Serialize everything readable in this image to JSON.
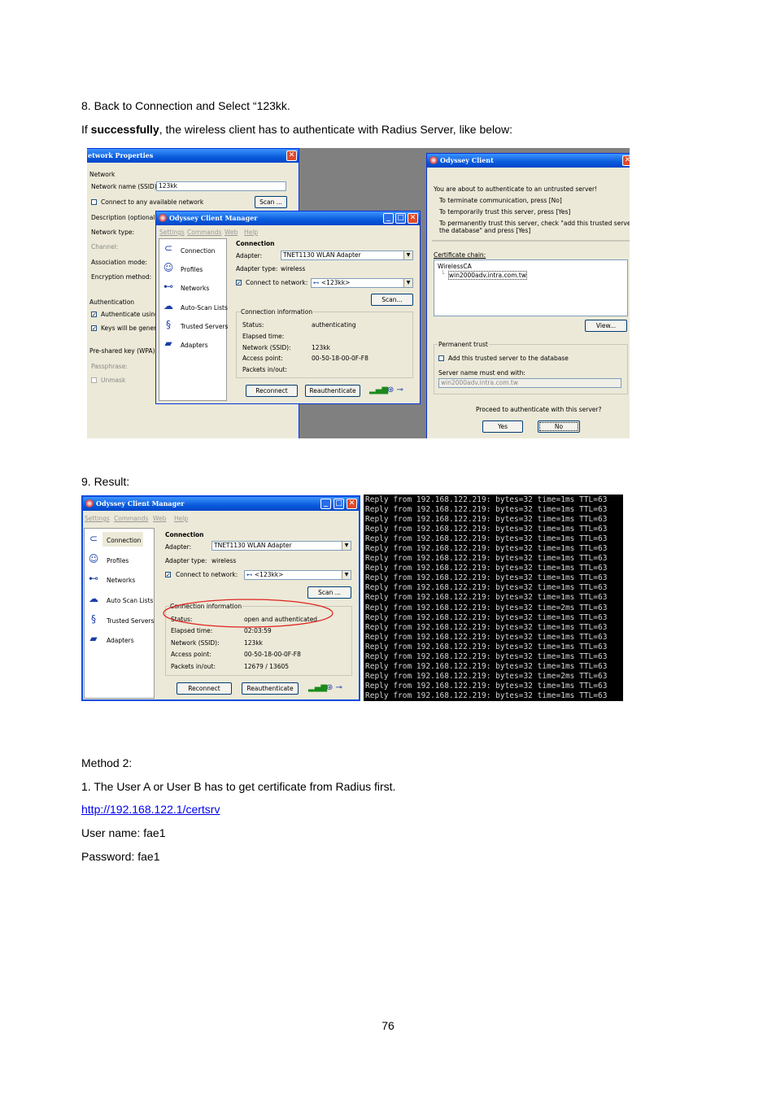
{
  "doc": {
    "step8": "8. Back to Connection and Select “123kk.",
    "line2_prefix": "If ",
    "line2_bold": "successfully",
    "line2_suffix": ", the wireless client has to authenticate with Radius Server, like below:",
    "step9": "9. Result:",
    "method2": "Method 2:",
    "method_step1": "1. The User A or User B has to get certificate from Radius first.",
    "url": "http://192.168.122.1/certsrv",
    "username": "User name: fae1",
    "password": "Password: fae1",
    "page_number": "76"
  },
  "fig1": {
    "netprops": {
      "title": "etwork Properties",
      "network_group": "Network",
      "ssid_label": "Network name (SSID):",
      "ssid_value": "123kk",
      "connect_any": "Connect to any available network",
      "scan": "Scan ...",
      "description": "Description (optional):",
      "network_type": "Network type:",
      "channel": "Channel:",
      "association": "Association mode:",
      "encryption": "Encryption method:",
      "auth_group": "Authentication",
      "auth_using": "Authenticate using",
      "keys_general": "Keys will be generat",
      "psk_group": "Pre-shared key (WPA)",
      "passphrase": "Passphrase:",
      "unmask": "Unmask"
    },
    "manager": {
      "title": "Odyssey Client Manager",
      "menu": [
        "Settings",
        "Commands",
        "Web",
        "Help"
      ],
      "nav": [
        "Connection",
        "Profiles",
        "Networks",
        "Auto-Scan Lists",
        "Trusted Servers",
        "Adapters"
      ],
      "section": "Connection",
      "adapter_label": "Adapter:",
      "adapter_value": "TNET1130 WLAN Adapter",
      "adapter_type_label": "Adapter type:",
      "adapter_type_value": "wireless",
      "connect_label": "Connect to network:",
      "connect_value": "<123kk>",
      "scan": "Scan...",
      "info_group": "Connection information",
      "status_label": "Status:",
      "status_value": "authenticating",
      "elapsed_label": "Elapsed time:",
      "ssid_label": "Network (SSID):",
      "ssid_value": "123kk",
      "ap_label": "Access point:",
      "ap_value": "00-50-18-00-0F-F8",
      "packets_label": "Packets in/out:",
      "reconnect": "Reconnect",
      "reauth": "Reauthenticate"
    },
    "odyssey": {
      "title": "Odyssey Client",
      "line1": "You are about to authenticate to an untrusted server!",
      "line2": "To terminate communication, press [No]",
      "line3": "To temporarily trust this server, press [Yes]",
      "line4": "To permanently trust this server, check \"add this trusted server to",
      "line5": "the database\" and press [Yes]",
      "cert_chain": "Certificate chain:",
      "cert_root": "WirelessCA",
      "cert_leaf": "win2000adv.intra.com.tw",
      "view": "View...",
      "perm_group": "Permanent trust",
      "add_trusted": "Add this trusted server to the database",
      "server_end": "Server name must end with:",
      "server_value": "win2000adv.intra.com.tw",
      "proceed": "Proceed to authenticate with this server?",
      "yes": "Yes",
      "no": "No"
    }
  },
  "fig2": {
    "manager": {
      "title": "Odyssey Client Manager",
      "menu": [
        "Settings",
        "Commands",
        "Web",
        "Help"
      ],
      "nav": [
        "Connection",
        "Profiles",
        "Networks",
        "Auto Scan Lists",
        "Trusted Servers",
        "Adapters"
      ],
      "section": "Connection",
      "adapter_label": "Adapter:",
      "adapter_value": "TNET1130 WLAN Adapter",
      "adapter_type_label": "Adapter type:",
      "adapter_type_value": "wireless",
      "connect_label": "Connect to network:",
      "connect_value": "<123kk>",
      "scan": "Scan ...",
      "info_group": "Connection information",
      "status_label": "Status:",
      "status_value": "open and authenticated",
      "elapsed_label": "Elapsed time:",
      "elapsed_value": "02:03:59",
      "ssid_label": "Network (SSID):",
      "ssid_value": "123kk",
      "ap_label": "Access point:",
      "ap_value": "00-50-18-00-0F-F8",
      "packets_label": "Packets in/out:",
      "packets_value": "12679 / 13605",
      "reconnect": "Reconnect",
      "reauth": "Reauthenticate",
      "highlight_color": "#e0201c"
    },
    "console_lines": [
      "Reply from 192.168.122.219: bytes=32 time=1ms TTL=63",
      "Reply from 192.168.122.219: bytes=32 time=1ms TTL=63",
      "Reply from 192.168.122.219: bytes=32 time=1ms TTL=63",
      "Reply from 192.168.122.219: bytes=32 time=1ms TTL=63",
      "Reply from 192.168.122.219: bytes=32 time=1ms TTL=63",
      "Reply from 192.168.122.219: bytes=32 time=1ms TTL=63",
      "Reply from 192.168.122.219: bytes=32 time=1ms TTL=63",
      "Reply from 192.168.122.219: bytes=32 time=1ms TTL=63",
      "Reply from 192.168.122.219: bytes=32 time=1ms TTL=63",
      "Reply from 192.168.122.219: bytes=32 time=1ms TTL=63",
      "Reply from 192.168.122.219: bytes=32 time=1ms TTL=63",
      "Reply from 192.168.122.219: bytes=32 time=2ms TTL=63",
      "Reply from 192.168.122.219: bytes=32 time=1ms TTL=63",
      "Reply from 192.168.122.219: bytes=32 time=1ms TTL=63",
      "Reply from 192.168.122.219: bytes=32 time=1ms TTL=63",
      "Reply from 192.168.122.219: bytes=32 time=1ms TTL=63",
      "Reply from 192.168.122.219: bytes=32 time=1ms TTL=63",
      "Reply from 192.168.122.219: bytes=32 time=1ms TTL=63",
      "Reply from 192.168.122.219: bytes=32 time=2ms TTL=63",
      "Reply from 192.168.122.219: bytes=32 time=1ms TTL=63",
      "Reply from 192.168.122.219: bytes=32 time=1ms TTL=63"
    ]
  }
}
